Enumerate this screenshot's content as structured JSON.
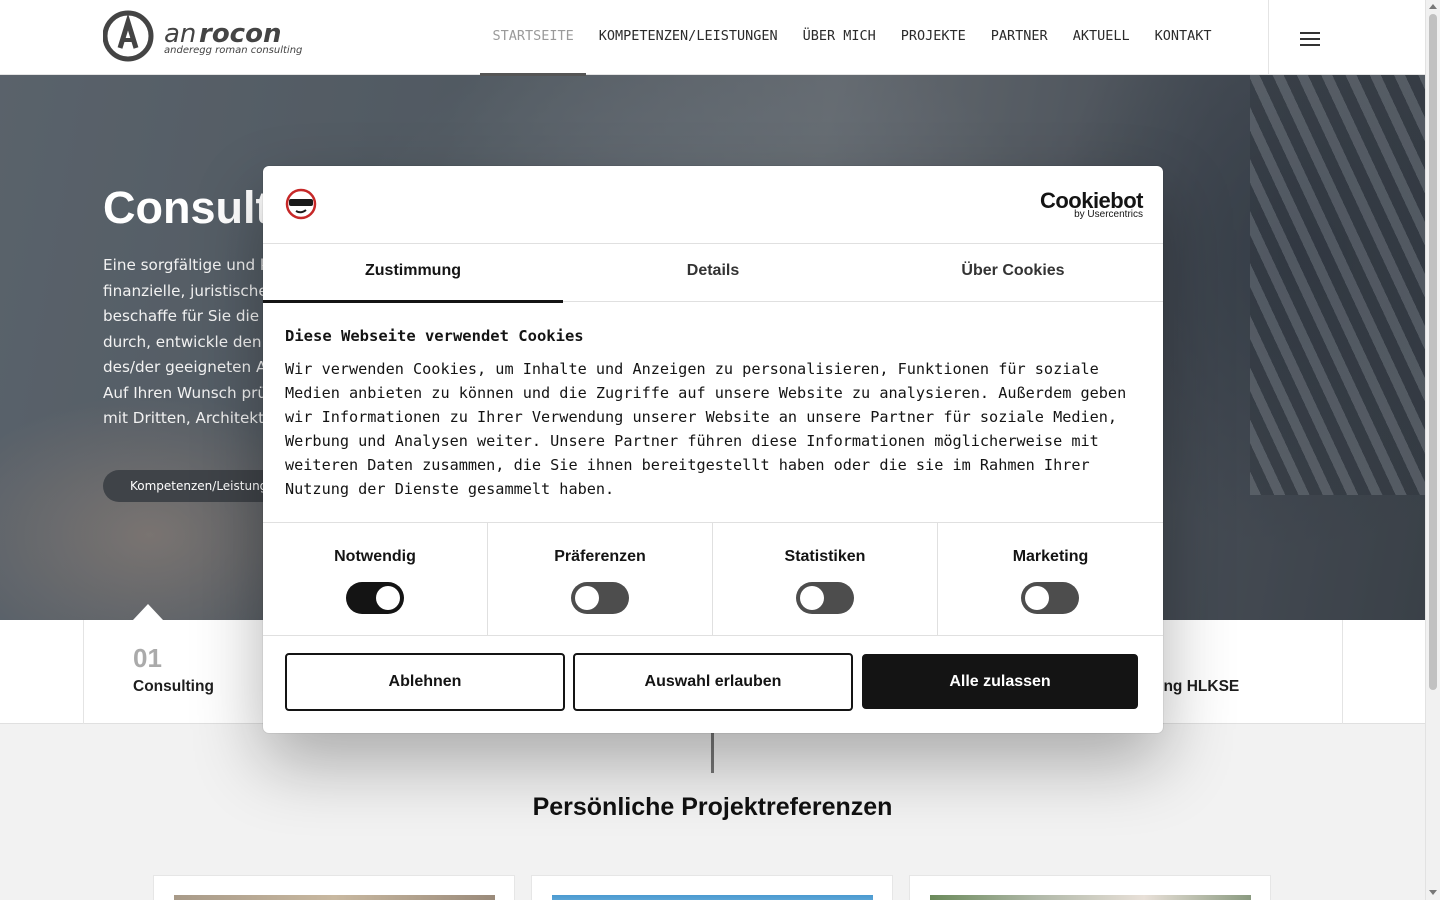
{
  "brand": {
    "logo_name": "anrocon",
    "logo_sub": "anderegg roman consulting"
  },
  "nav": {
    "items": [
      {
        "label": "STARTSEITE"
      },
      {
        "label": "KOMPETENZEN/LEISTUNGEN"
      },
      {
        "label": "ÜBER MICH"
      },
      {
        "label": "PROJEKTE"
      },
      {
        "label": "PARTNER"
      },
      {
        "label": "AKTUELL"
      },
      {
        "label": "KONTAKT"
      }
    ],
    "active": "STARTSEITE"
  },
  "hero": {
    "title": "Consult",
    "text_lines": [
      "Eine sorgfältige und ko",
      "finanzielle, juristische",
      "beschaffe für Sie die e",
      "durch, entwickle den e",
      "des/der geeigneten An",
      "Auf Ihren Wunsch prüf",
      "mit Dritten, Architekte"
    ],
    "button_label": "Kompetenzen/Leistungen"
  },
  "feature_tabs": {
    "first_number": "01",
    "first_label": "Consulting",
    "fourth_label_partial": "ung HLKSE"
  },
  "section": {
    "title": "Persönliche Projektreferenzen"
  },
  "cookie_dialog": {
    "provider_logo": "Cookiebot",
    "provider_sub": "by Usercentrics",
    "tabs": [
      {
        "label": "Zustimmung",
        "active": true
      },
      {
        "label": "Details",
        "active": false
      },
      {
        "label": "Über Cookies",
        "active": false
      }
    ],
    "title": "Diese Webseite verwendet Cookies",
    "text": "Wir verwenden Cookies, um Inhalte und Anzeigen zu personalisieren, Funktionen für soziale Medien anbieten zu können und die Zugriffe auf unsere Website zu analysieren. Außerdem geben wir Informationen zu Ihrer Verwendung unserer Website an unsere Partner für soziale Medien, Werbung und Analysen weiter. Unsere Partner führen diese Informationen möglicherweise mit weiteren Daten zusammen, die Sie ihnen bereitgestellt haben oder die sie im Rahmen Ihrer Nutzung der Dienste gesammelt haben.",
    "categories": [
      {
        "label": "Notwendig",
        "enabled": true
      },
      {
        "label": "Präferenzen",
        "enabled": false
      },
      {
        "label": "Statistiken",
        "enabled": false
      },
      {
        "label": "Marketing",
        "enabled": false
      }
    ],
    "buttons": {
      "decline": "Ablehnen",
      "allow_selection": "Auswahl erlauben",
      "allow_all": "Alle zulassen"
    }
  },
  "colors": {
    "primary_dark": "#141414",
    "toggle_off": "#4d4d4d",
    "nav_active": "#9a9a9a"
  }
}
